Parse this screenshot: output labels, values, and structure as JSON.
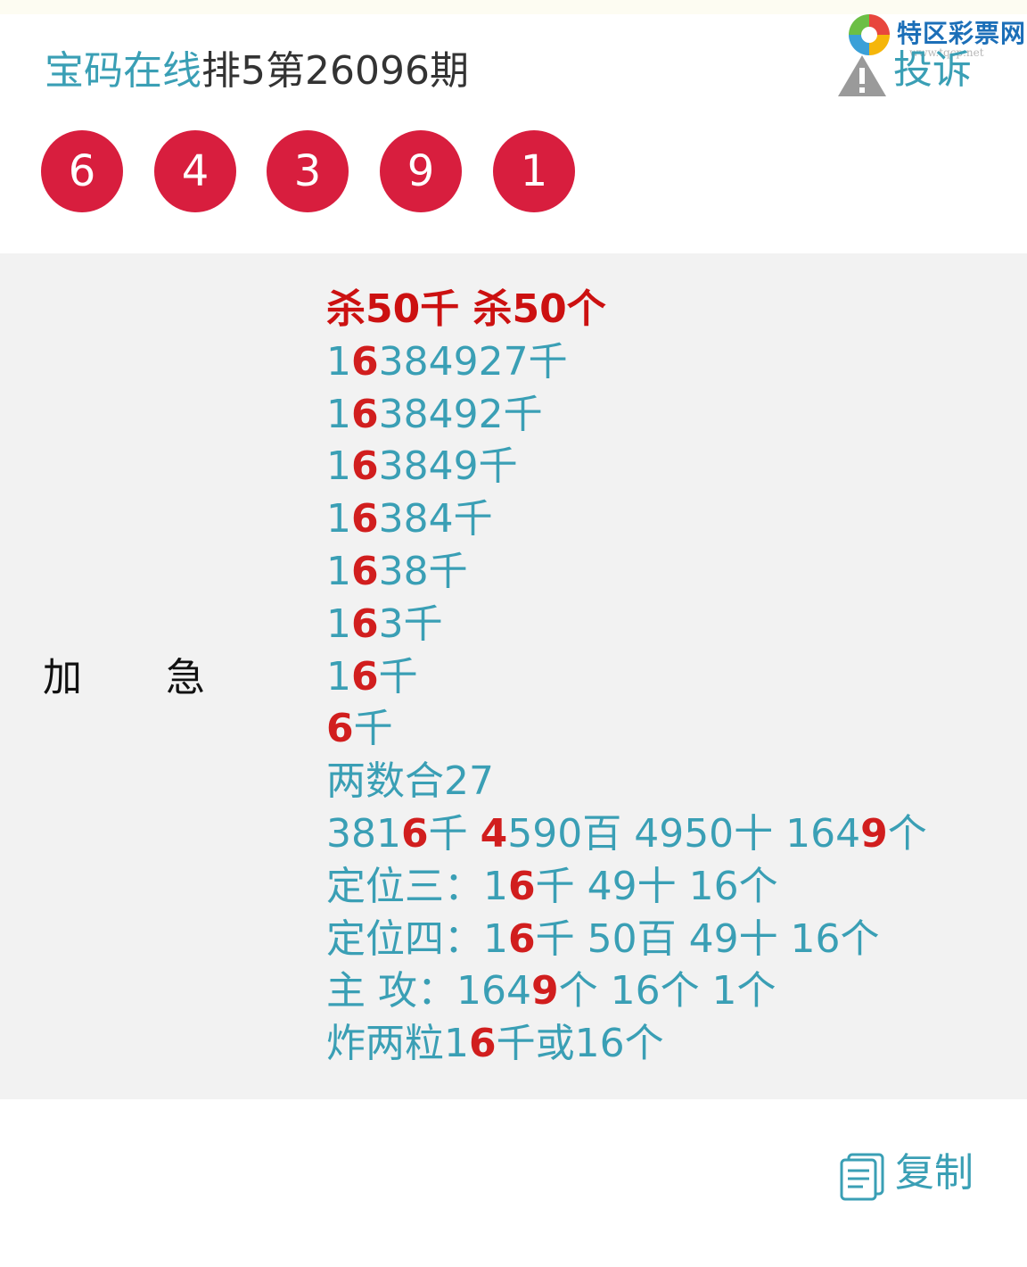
{
  "header": {
    "site_name": "宝码在线",
    "issue_title": "排5第26096期"
  },
  "watermark": {
    "name": "特区彩票网",
    "url": "www.tqcp.net"
  },
  "complain_label": "投诉",
  "draw_numbers": [
    "6",
    "4",
    "3",
    "9",
    "1"
  ],
  "section": {
    "label_1": "加",
    "label_2": "急",
    "lines": [
      {
        "style": "red",
        "segments": [
          {
            "text": "杀50千 杀50个",
            "hit": false
          }
        ]
      },
      {
        "segments": [
          {
            "text": "1",
            "hit": false
          },
          {
            "text": "6",
            "hit": true
          },
          {
            "text": "384927千",
            "hit": false
          }
        ]
      },
      {
        "segments": [
          {
            "text": "1",
            "hit": false
          },
          {
            "text": "6",
            "hit": true
          },
          {
            "text": "38492千",
            "hit": false
          }
        ]
      },
      {
        "segments": [
          {
            "text": "1",
            "hit": false
          },
          {
            "text": "6",
            "hit": true
          },
          {
            "text": "3849千",
            "hit": false
          }
        ]
      },
      {
        "segments": [
          {
            "text": "1",
            "hit": false
          },
          {
            "text": "6",
            "hit": true
          },
          {
            "text": "384千",
            "hit": false
          }
        ]
      },
      {
        "segments": [
          {
            "text": "1",
            "hit": false
          },
          {
            "text": "6",
            "hit": true
          },
          {
            "text": "38千",
            "hit": false
          }
        ]
      },
      {
        "segments": [
          {
            "text": "1",
            "hit": false
          },
          {
            "text": "6",
            "hit": true
          },
          {
            "text": "3千",
            "hit": false
          }
        ]
      },
      {
        "segments": [
          {
            "text": "1",
            "hit": false
          },
          {
            "text": "6",
            "hit": true
          },
          {
            "text": "千",
            "hit": false
          }
        ]
      },
      {
        "segments": [
          {
            "text": "6",
            "hit": true
          },
          {
            "text": "千",
            "hit": false
          }
        ]
      },
      {
        "segments": [
          {
            "text": "两数合27",
            "hit": false
          }
        ]
      },
      {
        "segments": [
          {
            "text": "381",
            "hit": false
          },
          {
            "text": "6",
            "hit": true
          },
          {
            "text": "千 ",
            "hit": false
          },
          {
            "text": "4",
            "hit": true
          },
          {
            "text": "590百 4950十 164",
            "hit": false
          },
          {
            "text": "9",
            "hit": true
          },
          {
            "text": "个",
            "hit": false
          }
        ]
      },
      {
        "segments": [
          {
            "text": "定位三：1",
            "hit": false
          },
          {
            "text": "6",
            "hit": true
          },
          {
            "text": "千 49十 16个",
            "hit": false
          }
        ]
      },
      {
        "segments": [
          {
            "text": "定位四：1",
            "hit": false
          },
          {
            "text": "6",
            "hit": true
          },
          {
            "text": "千 50百 49十 16个",
            "hit": false
          }
        ]
      },
      {
        "segments": [
          {
            "text": "主 攻：164",
            "hit": false
          },
          {
            "text": "9",
            "hit": true
          },
          {
            "text": "个 16个 1个",
            "hit": false
          }
        ]
      },
      {
        "segments": [
          {
            "text": "炸两粒1",
            "hit": false
          },
          {
            "text": "6",
            "hit": true
          },
          {
            "text": "千或16个",
            "hit": false
          }
        ]
      }
    ]
  },
  "copy_label": "复制",
  "colors": {
    "accent": "#3a9fb5",
    "ball": "#d81e3e",
    "highlight": "#d11e1e",
    "panel": "#f2f2f2"
  }
}
